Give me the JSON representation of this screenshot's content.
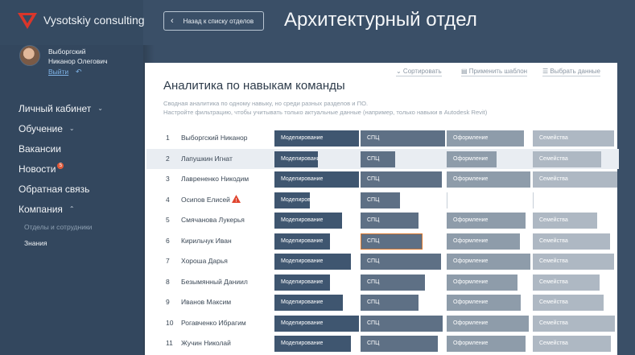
{
  "brand": {
    "name": "Vysotskiy consulting",
    "logo_color": "#d9362b"
  },
  "header": {
    "back_label": "Назад к списку отделов",
    "back_icon": "chevron-left-icon",
    "title": "Архитектурный отдел"
  },
  "user": {
    "name_line1": "Выборгский",
    "name_line2": "Никанор Олегович",
    "logout_label": "Выйти",
    "logout_icon": "logout-icon"
  },
  "nav": {
    "items": [
      {
        "label": "Личный кабинет",
        "caret": "⌄"
      },
      {
        "label": "Обучение",
        "caret": "⌄"
      },
      {
        "label": "Вакансии"
      },
      {
        "label": "Новости",
        "badge": "5"
      },
      {
        "label": "Обратная связь"
      },
      {
        "label": "Компания",
        "caret": "⌃"
      }
    ],
    "sub_items": [
      {
        "label": "Отделы и сотрудники"
      },
      {
        "label": "Знания"
      }
    ]
  },
  "card": {
    "title": "Аналитика по навыкам команды",
    "desc_line1": "Сводная аналитика по одному навыку, но среди разных разделов и ПО.",
    "desc_line2": "Настройте фильтрацию, чтобы учитывать только актуальные данные (например, только навыки в Autodesk Revit)",
    "sort_label": "⌄ Сортировать",
    "template_label": "Применить шаблон",
    "select_label": "Выбрать данные"
  },
  "colors": {
    "skill1": "#3f5670",
    "skill2": "#5e7085",
    "skill3": "#8e9caa",
    "skill4": "#aeb8c3",
    "highlight": "#e9edf2",
    "warning": "#e0452f"
  },
  "skills": [
    "Моделирование",
    "СПЦ",
    "Оформление",
    "Семейства"
  ],
  "rows": [
    {
      "num": "1",
      "name": "Выборгский Никанор",
      "levels": [
        1.0,
        1.0,
        0.91,
        0.96
      ]
    },
    {
      "num": "2",
      "name": "Лапушкин Игнат",
      "levels": [
        0.51,
        0.41,
        0.59,
        0.81
      ],
      "highlighted": true
    },
    {
      "num": "3",
      "name": "Лаврененко Никодим",
      "levels": [
        1.0,
        0.96,
        0.99,
        1.0
      ]
    },
    {
      "num": "4",
      "name": "Осипов Елисей",
      "levels": [
        0.42,
        0.47,
        0.0,
        0.0
      ],
      "warning": true
    },
    {
      "num": "5",
      "name": "Смячанова Лукерья",
      "levels": [
        0.8,
        0.69,
        0.93,
        0.76
      ]
    },
    {
      "num": "6",
      "name": "Кирильчук Иван",
      "levels": [
        0.66,
        0.73,
        0.87,
        0.91
      ],
      "outlined_skill": 1
    },
    {
      "num": "7",
      "name": "Хороша Дарья",
      "levels": [
        0.9,
        0.95,
        0.99,
        0.96
      ]
    },
    {
      "num": "8",
      "name": "Безымянный Даниил",
      "levels": [
        0.66,
        0.76,
        0.84,
        0.79
      ]
    },
    {
      "num": "9",
      "name": "Иванов Максим",
      "levels": [
        0.81,
        0.69,
        0.88,
        0.84
      ]
    },
    {
      "num": "10",
      "name": "Рогавченко Ибрагим",
      "levels": [
        1.0,
        0.97,
        0.97,
        0.97
      ]
    },
    {
      "num": "11",
      "name": "Жучин Николай",
      "levels": [
        0.9,
        0.91,
        0.93,
        0.92
      ]
    }
  ]
}
